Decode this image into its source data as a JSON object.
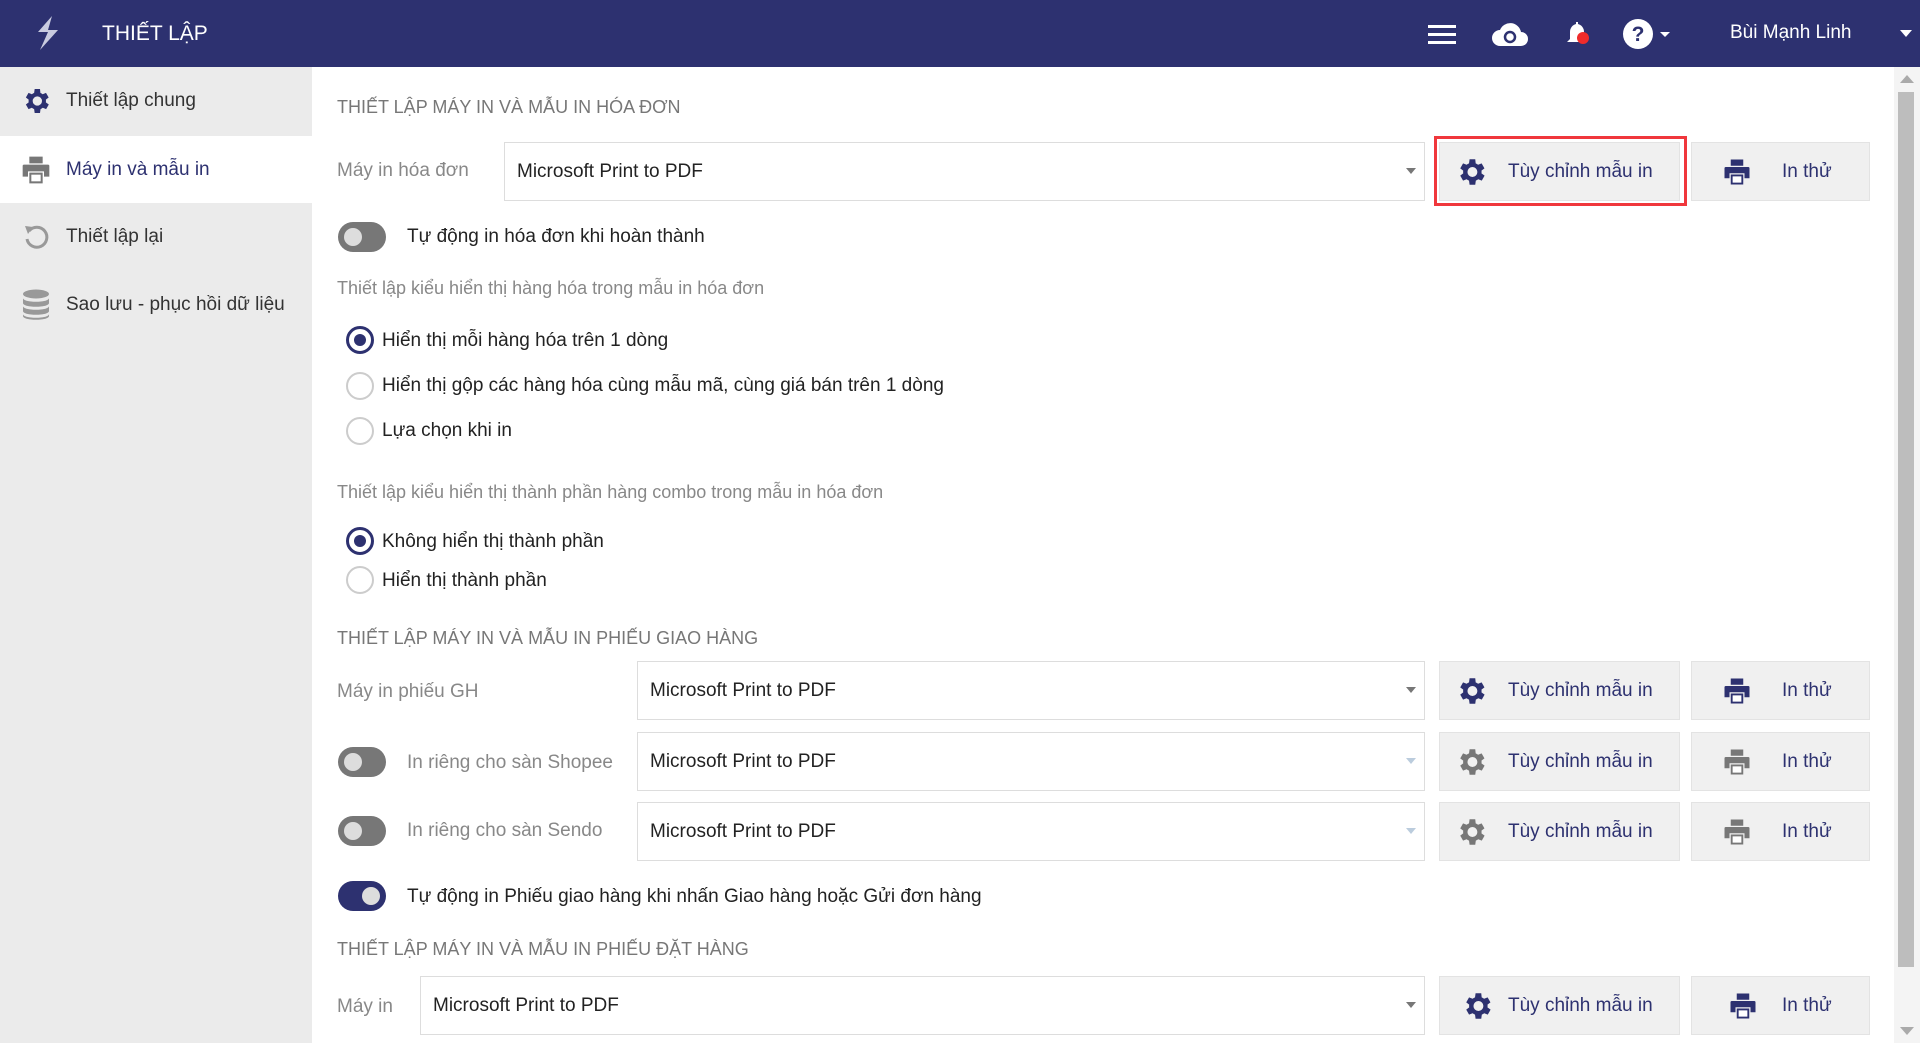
{
  "header": {
    "title": "THIẾT LẬP",
    "user": "Bùi Mạnh Linh"
  },
  "sidebar": {
    "items": [
      {
        "label": "Thiết lập chung"
      },
      {
        "label": "Máy in và mẫu in"
      },
      {
        "label": "Thiết lập lại"
      },
      {
        "label": "Sao lưu - phục hồi dữ liệu"
      }
    ]
  },
  "invoice": {
    "title": "THIẾT LẬP MÁY IN VÀ MẪU IN HÓA ĐƠN",
    "printer_label": "Máy in hóa đơn",
    "printer_value": "Microsoft Print to PDF",
    "auto_print": "Tự động in hóa đơn khi hoàn thành",
    "display_title": "Thiết lập kiểu hiển thị hàng hóa trong mẫu in hóa đơn",
    "display_options": [
      "Hiển thị mỗi hàng hóa trên 1 dòng",
      "Hiển thị gộp các hàng hóa cùng mẫu mã, cùng giá bán trên 1 dòng",
      "Lựa chọn khi in"
    ],
    "combo_title": "Thiết lập kiểu hiển thị thành phần hàng combo trong mẫu in hóa đơn",
    "combo_options": [
      "Không hiển thị thành phần",
      "Hiển thị thành phần"
    ]
  },
  "delivery": {
    "title": "THIẾT LẬP MÁY IN VÀ MẪU IN PHIẾU GIAO HÀNG",
    "printer_label": "Máy in phiếu GH",
    "printer_value": "Microsoft Print to PDF",
    "shopee_label": "In riêng cho sàn Shopee",
    "shopee_value": "Microsoft Print to PDF",
    "sendo_label": "In riêng cho sàn Sendo",
    "sendo_value": "Microsoft Print to PDF",
    "auto_print": "Tự động in Phiếu giao hàng khi nhấn Giao hàng hoặc Gửi đơn hàng"
  },
  "order": {
    "title": "THIẾT LẬP MÁY IN VÀ MẪU IN PHIẾU ĐẶT HÀNG",
    "printer_label": "Máy in",
    "printer_value": "Microsoft Print to PDF"
  },
  "buttons": {
    "customize": "Tùy chỉnh mẫu in",
    "test_print": "In thử"
  }
}
